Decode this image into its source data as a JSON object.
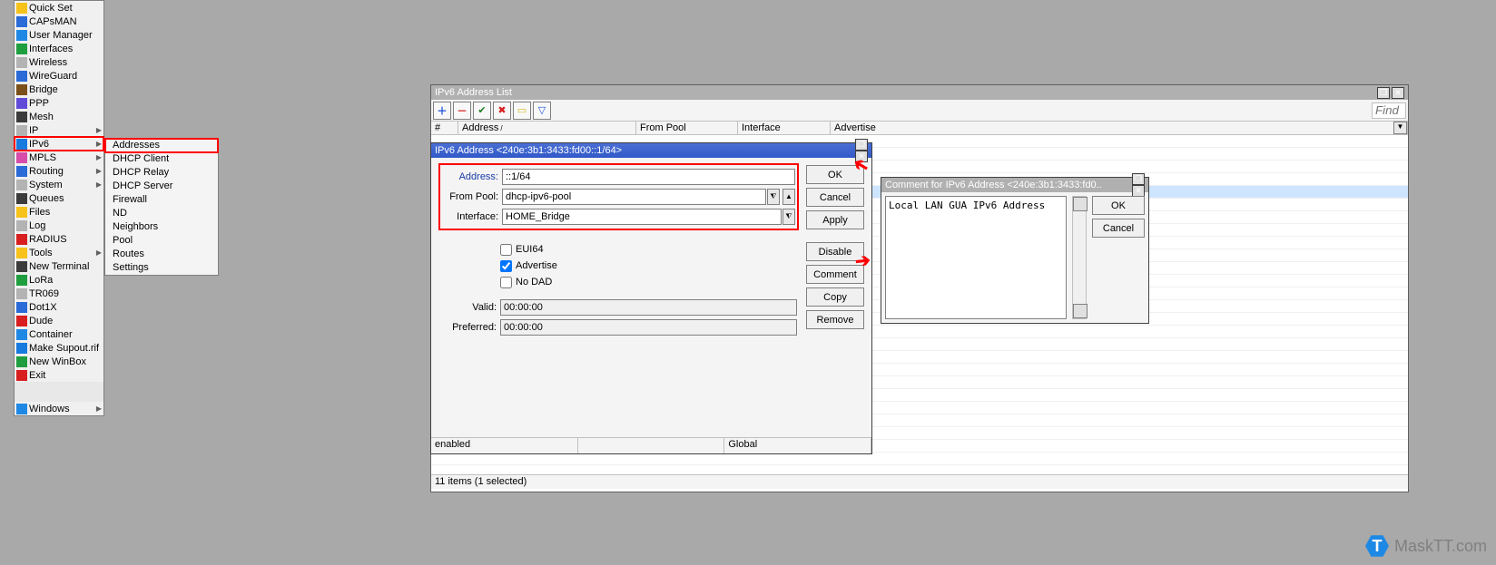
{
  "sidebar": {
    "items": [
      {
        "label": "Quick Set",
        "arrow": false
      },
      {
        "label": "CAPsMAN",
        "arrow": false
      },
      {
        "label": "User Manager",
        "arrow": false
      },
      {
        "label": "Interfaces",
        "arrow": false
      },
      {
        "label": "Wireless",
        "arrow": false
      },
      {
        "label": "WireGuard",
        "arrow": false
      },
      {
        "label": "Bridge",
        "arrow": false
      },
      {
        "label": "PPP",
        "arrow": false
      },
      {
        "label": "Mesh",
        "arrow": false
      },
      {
        "label": "IP",
        "arrow": true
      },
      {
        "label": "IPv6",
        "arrow": true,
        "highlighted": true
      },
      {
        "label": "MPLS",
        "arrow": true
      },
      {
        "label": "Routing",
        "arrow": true
      },
      {
        "label": "System",
        "arrow": true
      },
      {
        "label": "Queues",
        "arrow": false
      },
      {
        "label": "Files",
        "arrow": false
      },
      {
        "label": "Log",
        "arrow": false
      },
      {
        "label": "RADIUS",
        "arrow": false
      },
      {
        "label": "Tools",
        "arrow": true
      },
      {
        "label": "New Terminal",
        "arrow": false
      },
      {
        "label": "LoRa",
        "arrow": false
      },
      {
        "label": "TR069",
        "arrow": false
      },
      {
        "label": "Dot1X",
        "arrow": false
      },
      {
        "label": "Dude",
        "arrow": false
      },
      {
        "label": "Container",
        "arrow": false
      },
      {
        "label": "Make Supout.rif",
        "arrow": false
      },
      {
        "label": "New WinBox",
        "arrow": false
      },
      {
        "label": "Exit",
        "arrow": false
      }
    ],
    "windows_label": "Windows"
  },
  "submenu": {
    "items": [
      {
        "label": "Addresses",
        "highlighted": true
      },
      {
        "label": "DHCP Client"
      },
      {
        "label": "DHCP Relay"
      },
      {
        "label": "DHCP Server"
      },
      {
        "label": "Firewall"
      },
      {
        "label": "ND"
      },
      {
        "label": "Neighbors"
      },
      {
        "label": "Pool"
      },
      {
        "label": "Routes"
      },
      {
        "label": "Settings"
      }
    ]
  },
  "list_window": {
    "title": "IPv6 Address List",
    "find_placeholder": "Find",
    "columns": [
      "#",
      "Address",
      "From Pool",
      "Interface",
      "Advertise"
    ],
    "sort_indicator": "/",
    "status": "11 items (1 selected)"
  },
  "addr_dialog": {
    "title": "IPv6 Address <240e:3b1:3433:fd00::1/64>",
    "fields": {
      "address_label": "Address:",
      "address_value": "::1/64",
      "frompool_label": "From Pool:",
      "frompool_value": "dhcp-ipv6-pool",
      "interface_label": "Interface:",
      "interface_value": "HOME_Bridge",
      "eui64_label": "EUI64",
      "advertise_label": "Advertise",
      "nodad_label": "No DAD",
      "valid_label": "Valid:",
      "valid_value": "00:00:00",
      "preferred_label": "Preferred:",
      "preferred_value": "00:00:00"
    },
    "checkboxes": {
      "eui64": false,
      "advertise": true,
      "nodad": false
    },
    "buttons": {
      "ok": "OK",
      "cancel": "Cancel",
      "apply": "Apply",
      "disable": "Disable",
      "comment": "Comment",
      "copy": "Copy",
      "remove": "Remove"
    },
    "status": {
      "left": "enabled",
      "mid": "",
      "right": "Global"
    }
  },
  "comment_dialog": {
    "title": "Comment for IPv6 Address <240e:3b1:3433:fd0..",
    "text": "Local LAN GUA IPv6 Address",
    "buttons": {
      "ok": "OK",
      "cancel": "Cancel"
    }
  },
  "watermark": {
    "icon_letter": "T",
    "text": "MaskTT.com"
  }
}
